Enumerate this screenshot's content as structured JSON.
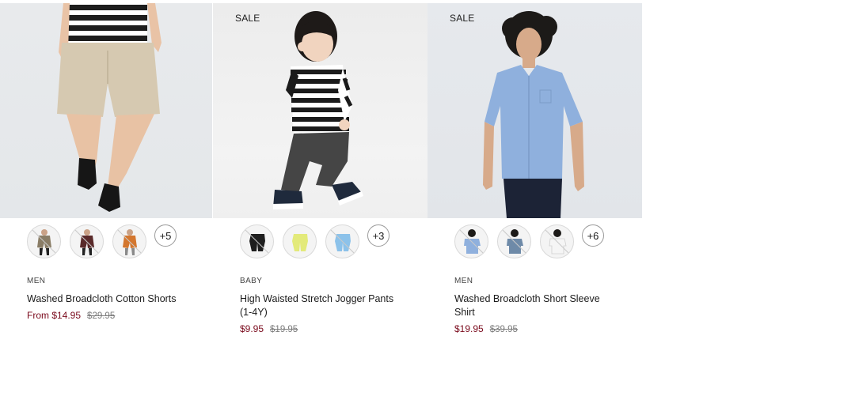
{
  "products": [
    {
      "sale_tag": "",
      "category": "MEN",
      "name": "Washed Broadcloth Cotton Shorts",
      "price": "From $14.95",
      "original_price": "$29.95",
      "more_colors": "+5",
      "swatch_colors": [
        "#8a7d66",
        "#5a2a2a",
        "#d4772f"
      ]
    },
    {
      "sale_tag": "SALE",
      "category": "BABY",
      "name": "High Waisted Stretch Jogger Pants (1-4Y)",
      "price": "$9.95",
      "original_price": "$19.95",
      "more_colors": "+3",
      "swatch_colors": [
        "#1e1e1e",
        "#e3ea7a",
        "#8cc2ea"
      ]
    },
    {
      "sale_tag": "SALE",
      "category": "MEN",
      "name": "Washed Broadcloth Short Sleeve Shirt",
      "price": "$19.95",
      "original_price": "$39.95",
      "more_colors": "+6",
      "swatch_colors": [
        "#8fb0dd",
        "#6e8aa8",
        "#f5f5f5"
      ]
    }
  ],
  "colors": {
    "sale_price": "#7a0a1c",
    "strike_price": "#7b7b7b"
  }
}
